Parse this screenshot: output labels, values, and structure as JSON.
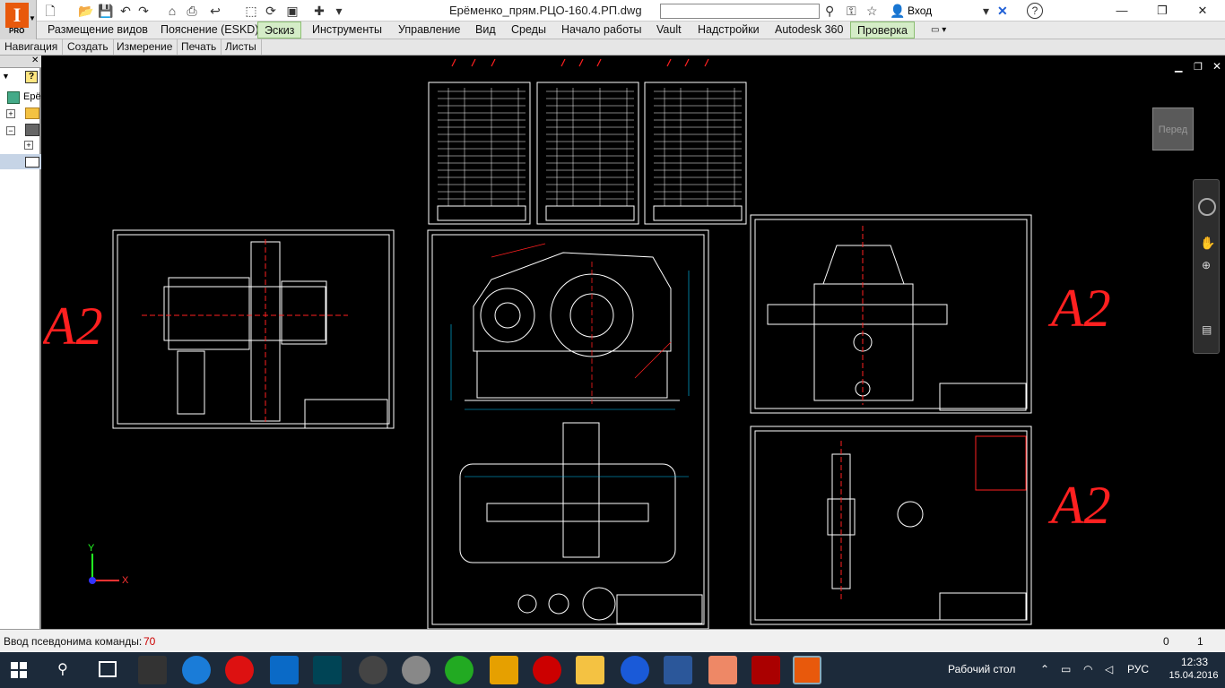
{
  "app": {
    "logo_letter": "I",
    "logo_edition": "PRO"
  },
  "titlebar": {
    "document_title": "Ерёменко_прям.РЦО-160.4.РП.dwg",
    "login_label": "Вход",
    "search_placeholder": ""
  },
  "ribbon_tabs": [
    {
      "label": "Размещение видов",
      "active": false
    },
    {
      "label": "Пояснение (ESKD)",
      "active": false
    },
    {
      "label": "Эскиз",
      "active": true
    },
    {
      "label": "Инструменты",
      "active": false
    },
    {
      "label": "Управление",
      "active": false
    },
    {
      "label": "Вид",
      "active": false
    },
    {
      "label": "Среды",
      "active": false
    },
    {
      "label": "Начало работы",
      "active": false
    },
    {
      "label": "Vault",
      "active": false
    },
    {
      "label": "Надстройки",
      "active": false
    },
    {
      "label": "Autodesk 360",
      "active": false
    },
    {
      "label": "Проверка",
      "active": true
    }
  ],
  "sub_tabs": [
    "Навигация",
    "Создать",
    "Измерение",
    "Печать",
    "Листы"
  ],
  "browser": {
    "root_label": "Ерё"
  },
  "canvas": {
    "sheet_labels": [
      "A2",
      "A2",
      "A2"
    ],
    "viewcube_label": "Перед",
    "axis_x": "X",
    "axis_y": "Y"
  },
  "command_line": {
    "label": "Ввод псевдонима команды:",
    "value": "70",
    "counter_left": "0",
    "counter_right": "1"
  },
  "taskbar": {
    "desktop_label": "Рабочий стол",
    "language": "РУС",
    "time": "12:33",
    "date": "15.04.2016"
  },
  "colors": {
    "drawing_white": "#ffffff",
    "drawing_red": "#ff2020",
    "drawing_cyan": "#00c8ff",
    "active_tab": "#d4ecc7"
  }
}
